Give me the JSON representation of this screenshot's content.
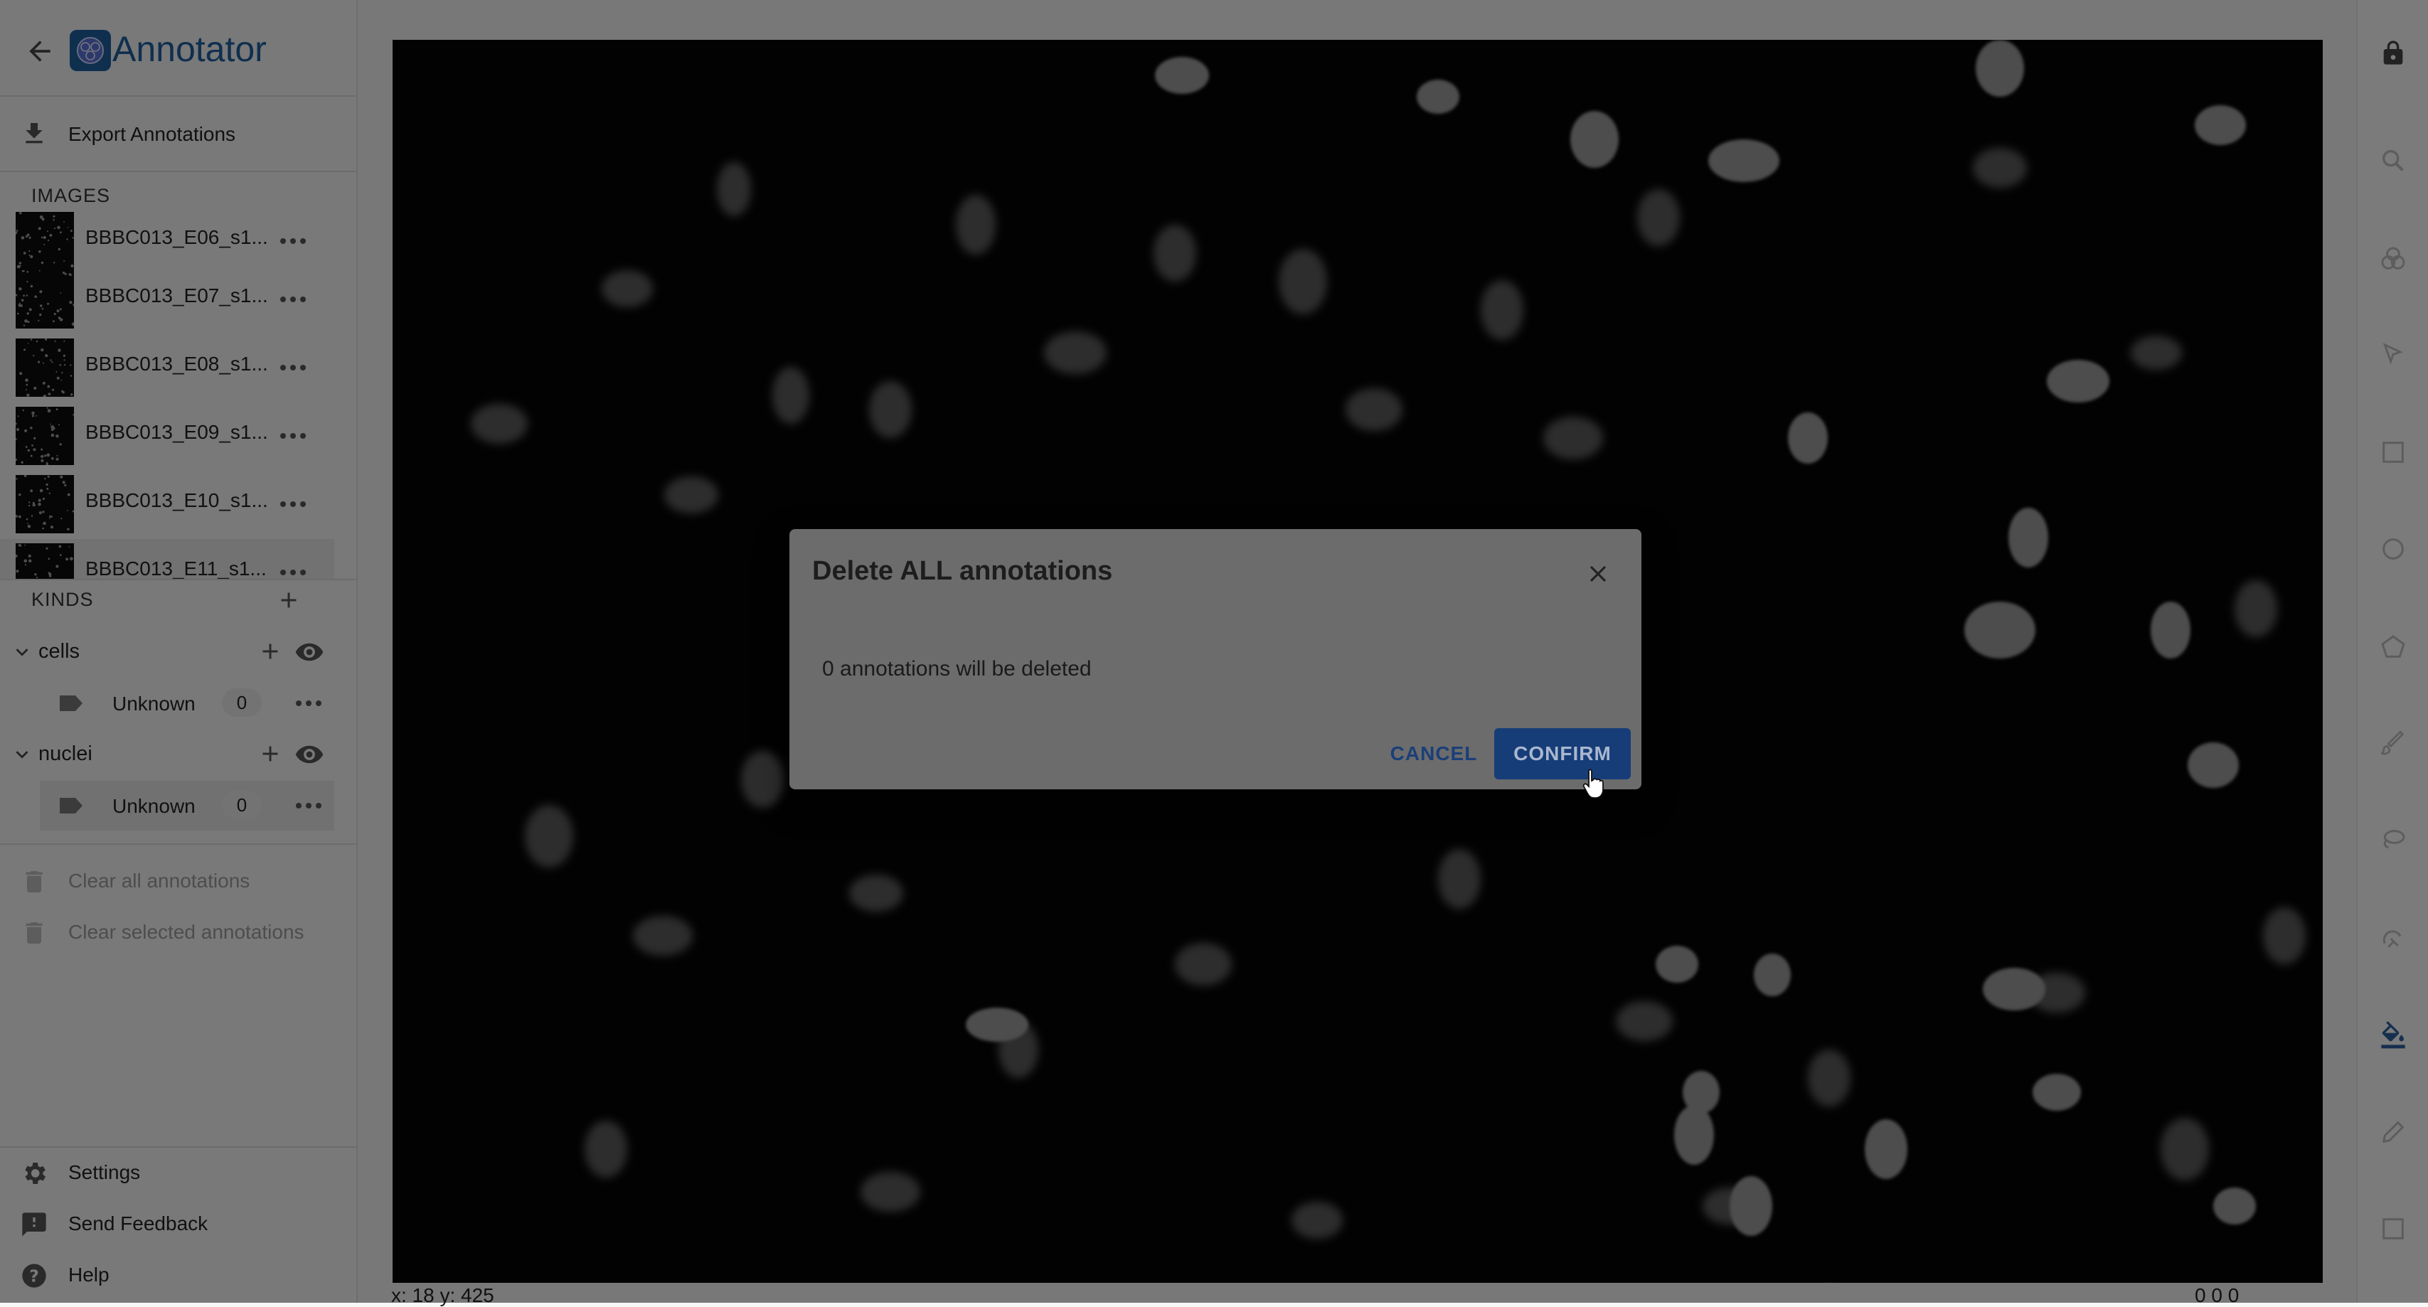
{
  "app": {
    "title": "Annotator",
    "accent": "#1f5f9e"
  },
  "sidebar": {
    "export_label": "Export Annotations",
    "images_header": "IMAGES",
    "images": [
      {
        "name": "BBBC013_E06_s1..."
      },
      {
        "name": "BBBC013_E07_s1..."
      },
      {
        "name": "BBBC013_E08_s1..."
      },
      {
        "name": "BBBC013_E09_s1..."
      },
      {
        "name": "BBBC013_E10_s1..."
      },
      {
        "name": "BBBC013_E11_s1..."
      }
    ],
    "kinds_header": "KINDS",
    "kinds": [
      {
        "name": "cells",
        "categories": [
          {
            "name": "Unknown",
            "count": "0"
          }
        ]
      },
      {
        "name": "nuclei",
        "categories": [
          {
            "name": "Unknown",
            "count": "0"
          }
        ]
      }
    ],
    "clear_all_label": "Clear all annotations",
    "clear_selected_label": "Clear selected annotations",
    "settings_label": "Settings",
    "feedback_label": "Send Feedback",
    "help_label": "Help"
  },
  "canvas": {
    "coords": "x: 18 y: 425",
    "zoom": "0 0 0"
  },
  "toolbar": {
    "tools": [
      "lock-icon",
      "zoom-icon",
      "color-adjust-icon",
      "pointer-icon",
      "rectangle-icon",
      "ellipse-icon",
      "polygon-icon",
      "brush-icon",
      "lasso-icon",
      "magnetic-icon",
      "color-fill-icon",
      "pen-icon",
      "select-box-icon"
    ],
    "active_tool": "color-fill-icon"
  },
  "dialog": {
    "title": "Delete ALL annotations",
    "body": "0 annotations will be deleted",
    "cancel_label": "CANCEL",
    "confirm_label": "CONFIRM",
    "confirm_color": "#163d78"
  }
}
